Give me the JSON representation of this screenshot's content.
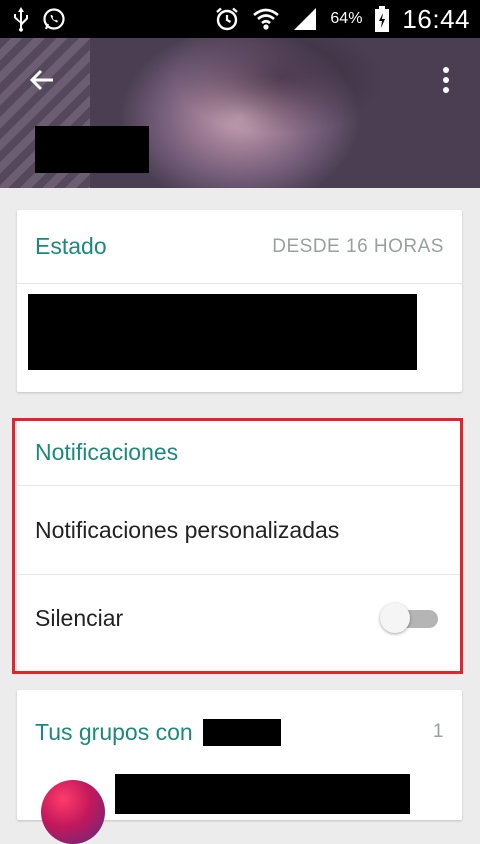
{
  "status_bar": {
    "battery_percent": "64%",
    "time": "16:44",
    "icons": [
      "usb-icon",
      "whatsapp-icon",
      "alarm-icon",
      "wifi-icon",
      "signal-icon",
      "battery-icon"
    ]
  },
  "header": {
    "back_icon": "back-arrow-icon",
    "menu_icon": "overflow-menu-icon"
  },
  "status_card": {
    "title": "Estado",
    "since": "DESDE 16 HORAS"
  },
  "notifications_card": {
    "title": "Notificaciones",
    "custom_label": "Notificaciones personalizadas",
    "mute_label": "Silenciar",
    "mute_on": false
  },
  "groups_card": {
    "title": "Tus grupos con",
    "count": "1"
  },
  "colors": {
    "accent": "#1a8a7c",
    "highlight_border": "#e02430",
    "background": "#ececec"
  }
}
